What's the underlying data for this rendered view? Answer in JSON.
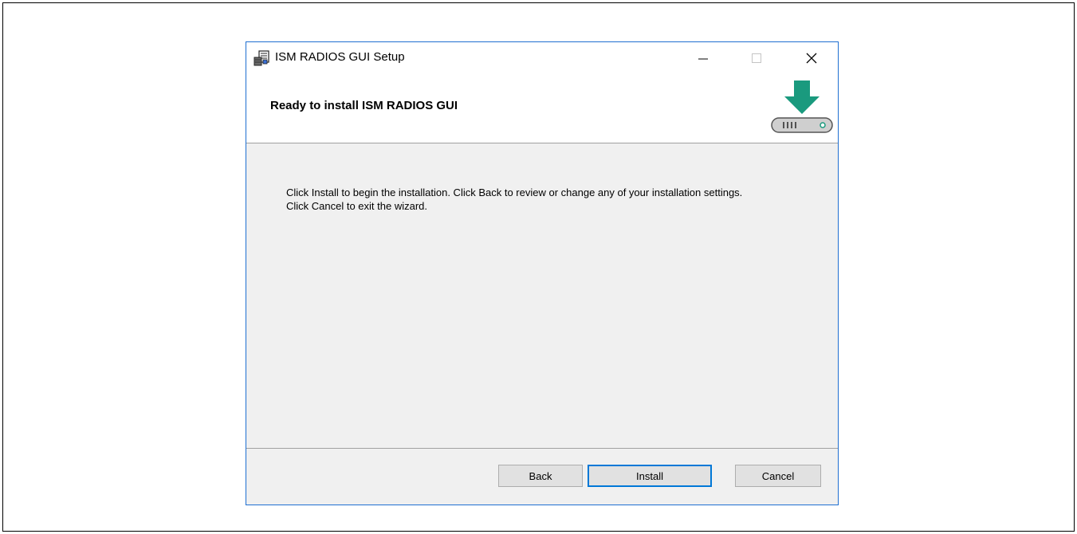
{
  "window": {
    "title": "ISM RADIOS GUI Setup",
    "minimize_icon": "minimize-icon",
    "maximize_icon": "maximize-icon",
    "close_icon": "close-icon"
  },
  "header": {
    "title": "Ready to install ISM RADIOS GUI",
    "graphic_icon": "drive-download-icon"
  },
  "content": {
    "message": "Click Install to begin the installation. Click Back to review or change any of your installation settings. Click Cancel to exit the wizard."
  },
  "buttons": {
    "back": "Back",
    "install": "Install",
    "cancel": "Cancel"
  },
  "colors": {
    "accent": "#0078d7",
    "arrow": "#1a9a7e",
    "window_border": "#1f6fd1",
    "panel_bg": "#f0f0f0"
  }
}
